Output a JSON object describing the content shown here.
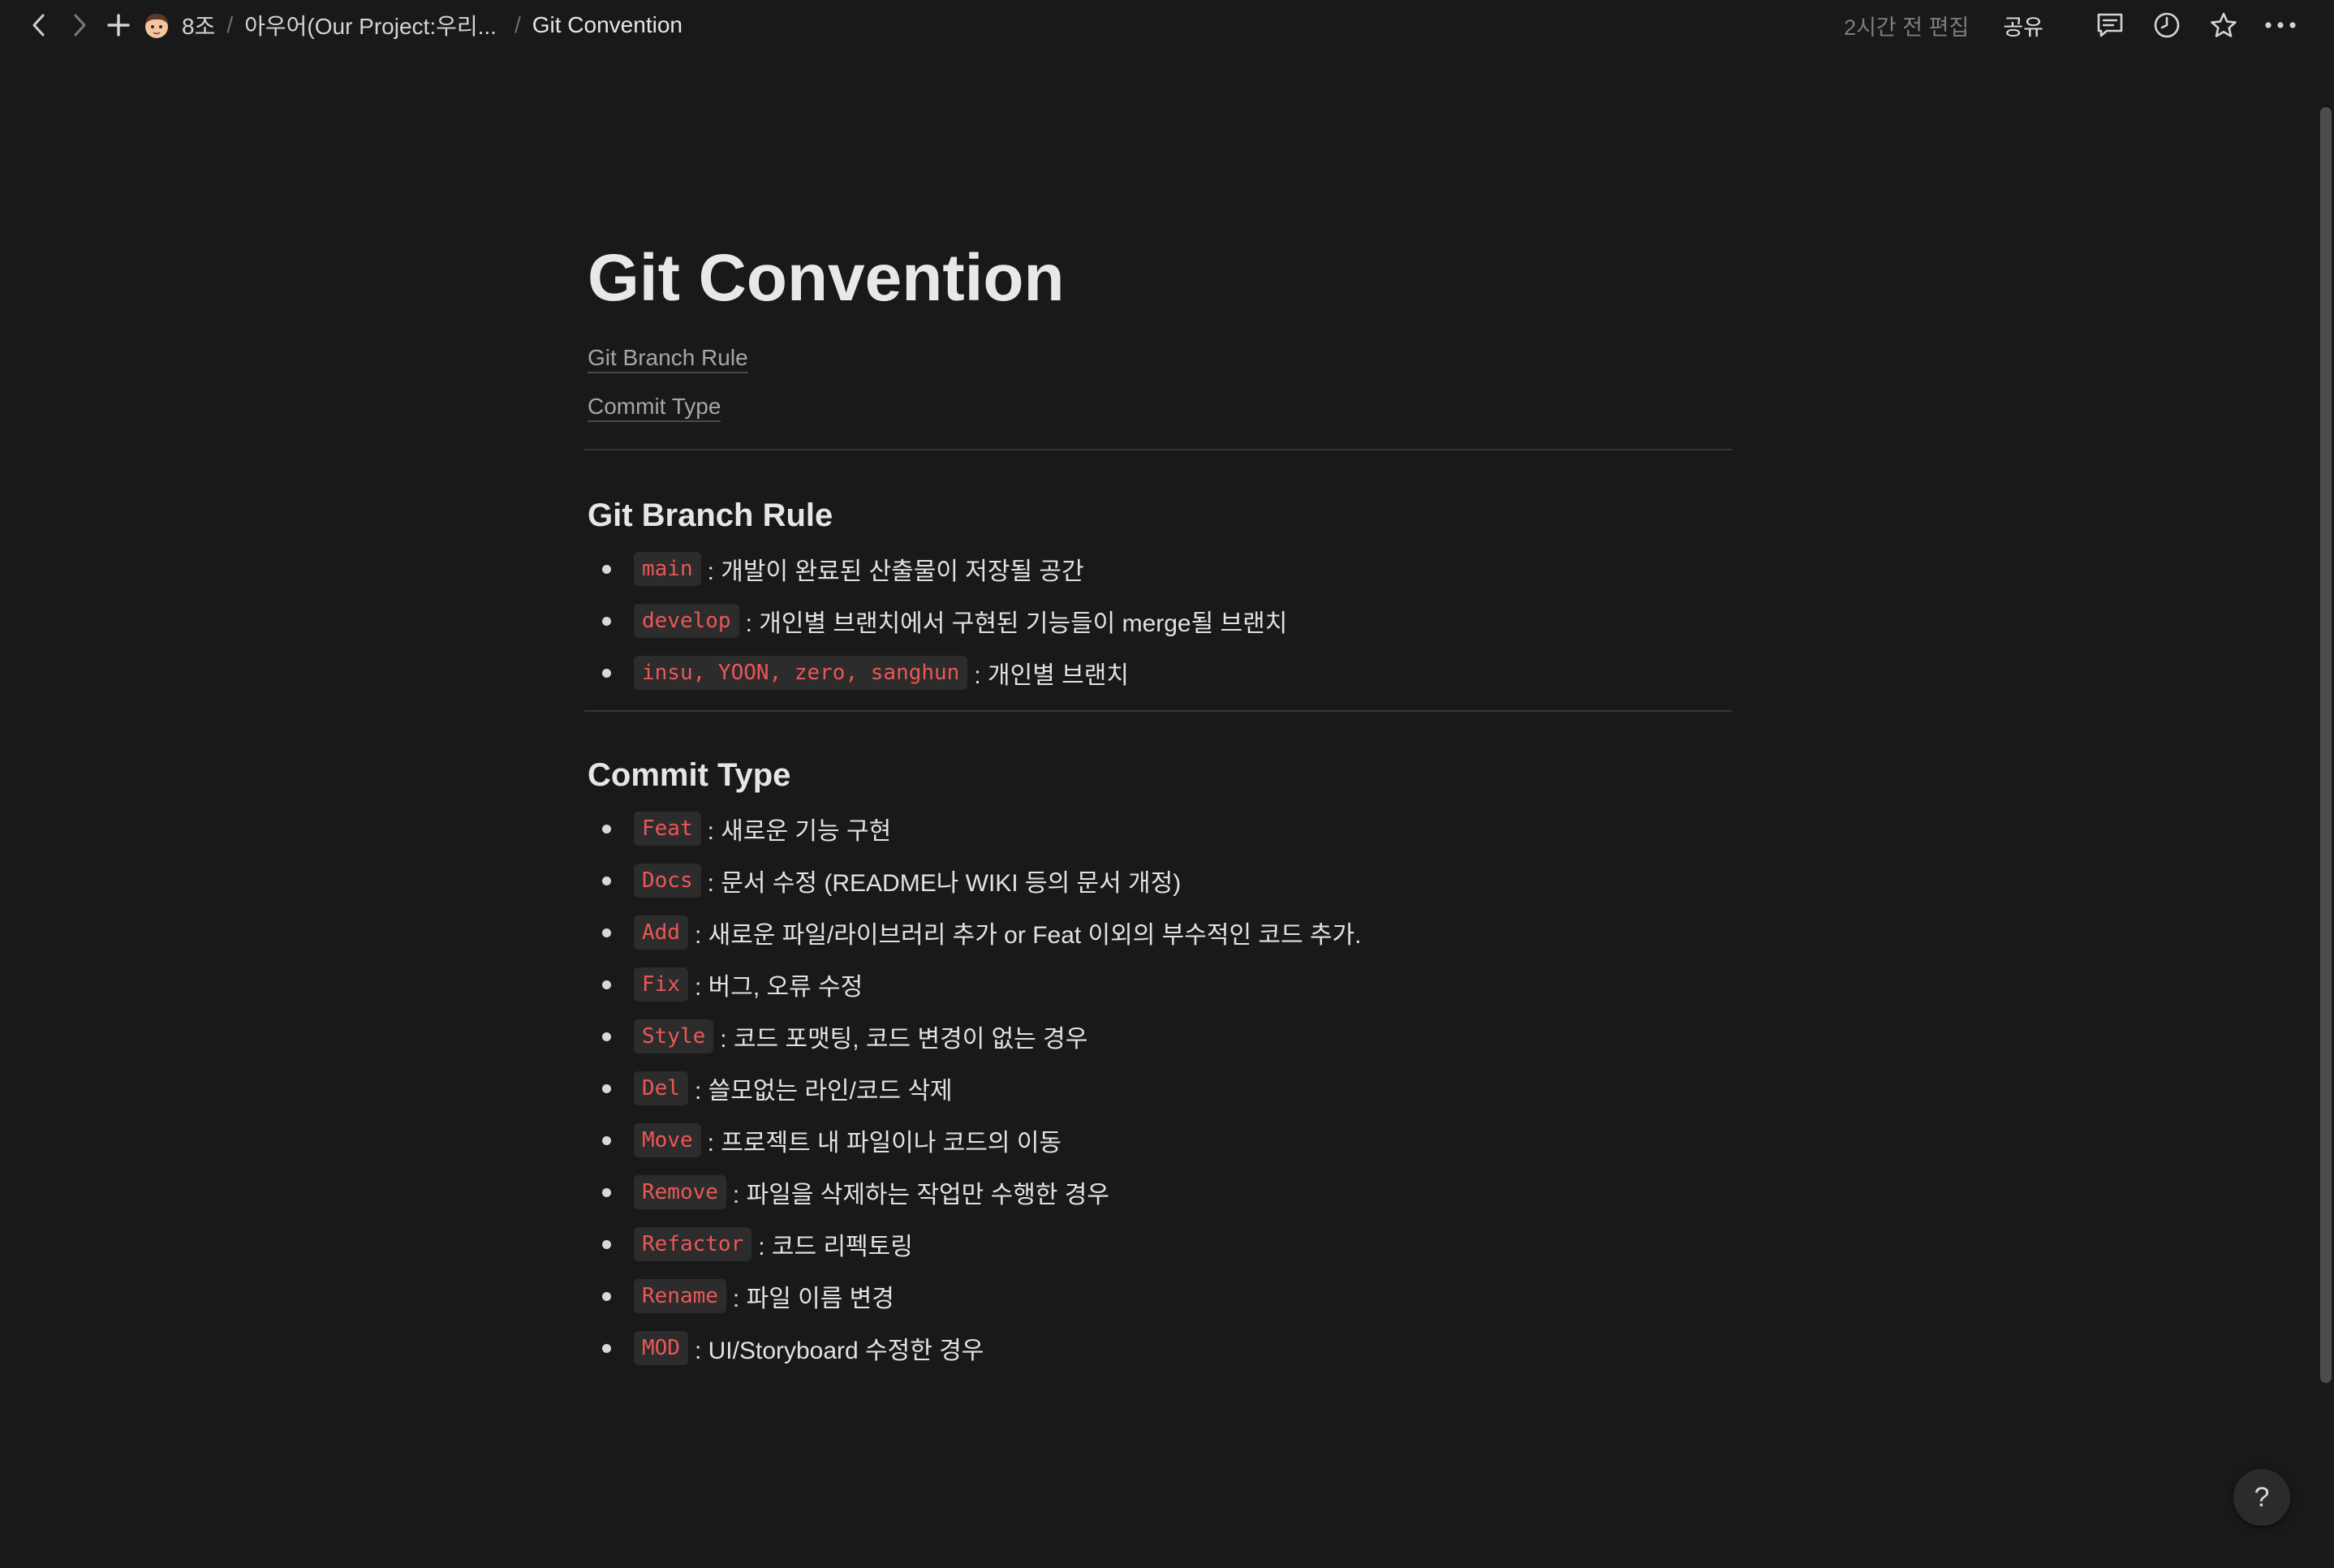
{
  "topbar": {
    "breadcrumb": {
      "workspace": "8조",
      "parent": "아우어(Our Project:우리...",
      "current": "Git Convention",
      "separator": "/"
    },
    "edited": "2시간 전 편집",
    "share": "공유",
    "icons": [
      "back-arrow-icon",
      "forward-arrow-icon",
      "plus-icon",
      "avatar-emoji-icon",
      "comment-icon",
      "clock-icon",
      "star-icon",
      "more-icon"
    ]
  },
  "page": {
    "title": "Git Convention",
    "toc": [
      "Git Branch Rule",
      "Commit Type"
    ],
    "sections": {
      "branch": {
        "heading": "Git Branch Rule",
        "items": [
          {
            "code": "main",
            "text": ": 개발이 완료된 산출물이 저장될 공간"
          },
          {
            "code": "develop",
            "text": ": 개인별 브랜치에서 구현된 기능들이 merge될 브랜치"
          },
          {
            "code": "insu, YOON, zero, sanghun",
            "text": ": 개인별 브랜치"
          }
        ]
      },
      "commit": {
        "heading": "Commit Type",
        "items": [
          {
            "code": "Feat",
            "text": ": 새로운 기능 구현"
          },
          {
            "code": "Docs",
            "text": ": 문서 수정 (README나 WIKI 등의 문서 개정)"
          },
          {
            "code": "Add",
            "text": ": 새로운 파일/라이브러리 추가 or Feat 이외의 부수적인 코드 추가."
          },
          {
            "code": "Fix",
            "text": ": 버그, 오류 수정"
          },
          {
            "code": "Style",
            "text": ": 코드 포맷팅, 코드 변경이 없는 경우"
          },
          {
            "code": "Del",
            "text": ": 쓸모없는 라인/코드 삭제"
          },
          {
            "code": "Move",
            "text": ": 프로젝트 내 파일이나 코드의 이동"
          },
          {
            "code": "Remove",
            "text": ": 파일을 삭제하는 작업만 수행한 경우"
          },
          {
            "code": "Refactor",
            "text": ": 코드 리펙토링"
          },
          {
            "code": "Rename",
            "text": ": 파일 이름 변경"
          },
          {
            "code": "MOD",
            "text": ":  UI/Storyboard 수정한 경우"
          }
        ]
      }
    }
  },
  "help": {
    "label": "?"
  },
  "colors": {
    "background": "#191919",
    "inline_code_text": "#eb5757",
    "inline_code_bg": "#2c2c2c",
    "divider": "#373737"
  }
}
